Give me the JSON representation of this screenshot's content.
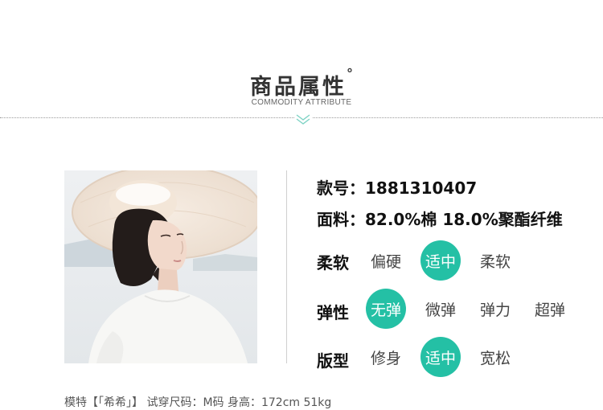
{
  "header": {
    "title": "商品属性",
    "title_mark": "°",
    "subtitle": "COMMODITY ATTRIBUTE"
  },
  "colors": {
    "accent": "#24c0a5",
    "chevron": "#7fd3c5"
  },
  "product": {
    "code_label": "款号：",
    "code_value": "1881310407",
    "fabric_label": "面料：",
    "fabric_value": "82.0%棉 18.0%聚酯纤维"
  },
  "attributes": [
    {
      "label": "柔软",
      "options": [
        "偏硬",
        "适中",
        "柔软"
      ],
      "selected": "适中"
    },
    {
      "label": "弹性",
      "options": [
        "无弹",
        "微弹",
        "弹力",
        "超弹"
      ],
      "selected": "无弹"
    },
    {
      "label": "版型",
      "options": [
        "修身",
        "适中",
        "宽松"
      ],
      "selected": "适中"
    }
  ],
  "footer": {
    "model_text": "模特【「希希」】 试穿尺码：M码 身高：172cm 51kg"
  },
  "icons": {
    "divider_chevron": "double-chevron-down-icon"
  }
}
